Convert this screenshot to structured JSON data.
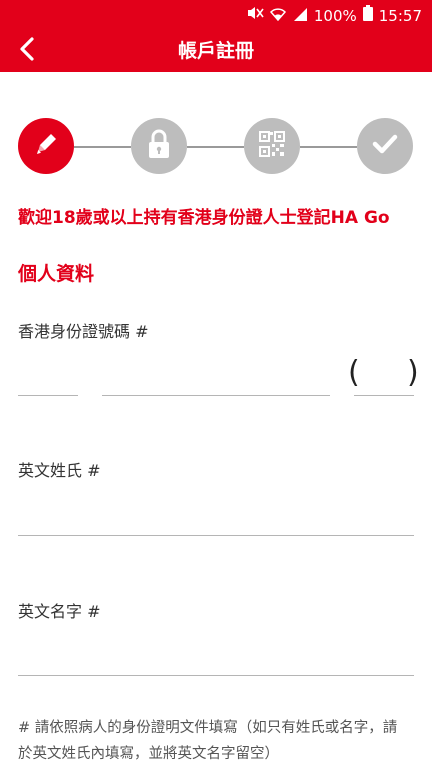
{
  "status_bar": {
    "battery": "100%",
    "time": "15:57",
    "icons": [
      "mute-icon",
      "wifi-icon",
      "signal-icon",
      "battery-icon"
    ]
  },
  "app_bar": {
    "title": "帳戶註冊",
    "back_icon": "back-arrow-icon"
  },
  "steps": [
    {
      "icon": "pencil-icon",
      "active": true
    },
    {
      "icon": "lock-icon",
      "active": false
    },
    {
      "icon": "qr-code-icon",
      "active": false
    },
    {
      "icon": "check-icon",
      "active": false
    }
  ],
  "welcome_text": "歡迎18歲或以上持有香港身份證人士登記HA Go",
  "section_title": "個人資料",
  "form": {
    "hkid_label": "香港身份證號碼 #",
    "hkid_open_paren": "(",
    "hkid_close_paren": ")",
    "surname_label": "英文姓氏 #",
    "given_name_label": "英文名字 #"
  },
  "hint": "# 請依照病人的身份證明文件填寫（如只有姓氏或名字，請於英文姓氏內填寫，並將英文名字留空）",
  "colors": {
    "brand_red": "#e2001a",
    "step_inactive": "#bdbdbd"
  }
}
